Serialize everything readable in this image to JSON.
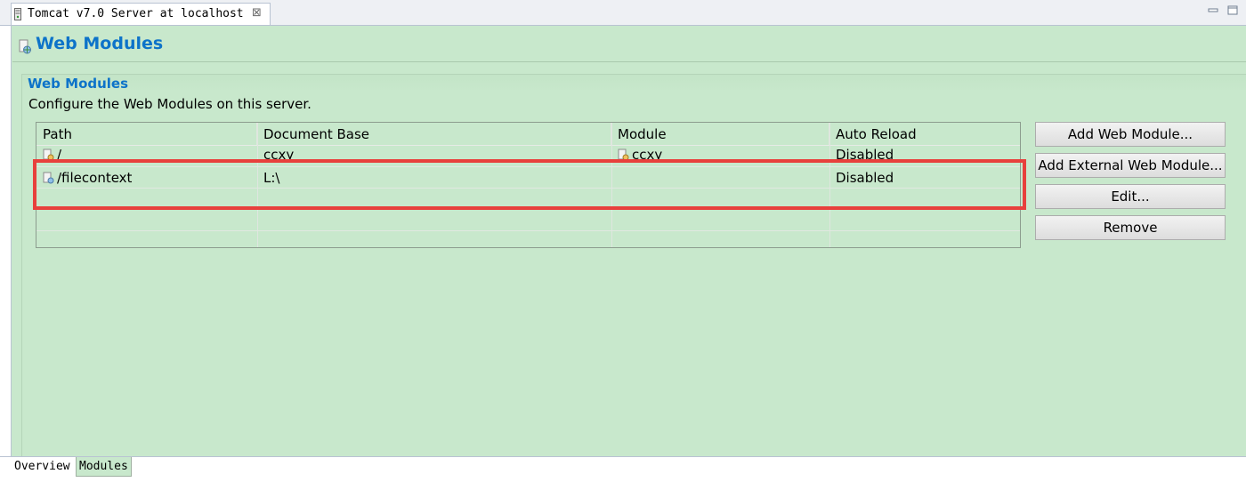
{
  "editor_tab": {
    "title": "Tomcat v7.0 Server at localhost",
    "close_glyph": "⊠"
  },
  "window_controls": {
    "minimize_glyph": "▭",
    "maximize_glyph": "▭"
  },
  "page": {
    "title": "Web Modules"
  },
  "section": {
    "title": "Web Modules",
    "description": "Configure the Web Modules on this server."
  },
  "table": {
    "columns": [
      "Path",
      "Document Base",
      "Module",
      "Auto Reload"
    ],
    "rows": [
      {
        "path": "/",
        "document_base": "ccxy",
        "module": "ccxy",
        "auto_reload": "Disabled"
      },
      {
        "path": "/filecontext",
        "document_base": "L:\\",
        "module": "",
        "auto_reload": "Disabled"
      }
    ]
  },
  "buttons": {
    "add_web_module": "Add Web Module...",
    "add_external_web_module": "Add External Web Module...",
    "edit": "Edit...",
    "remove": "Remove"
  },
  "page_tabs": {
    "overview": "Overview",
    "modules": "Modules"
  },
  "colors": {
    "background": "#c8e8cc",
    "title_blue": "#0d73c9",
    "highlight_red": "#e8403c"
  },
  "icons": [
    "server-icon",
    "web-module-icon",
    "project-icon"
  ]
}
